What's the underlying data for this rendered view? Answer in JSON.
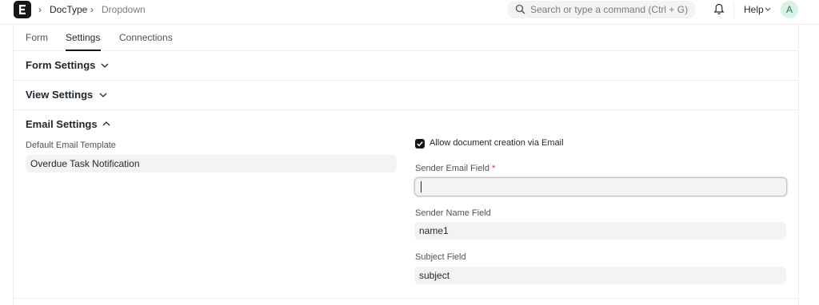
{
  "navbar": {
    "logo_letter": "E",
    "breadcrumb": [
      "DocType",
      "Dropdown"
    ],
    "search_placeholder": "Search or type a command (Ctrl + G)",
    "help_label": "Help",
    "avatar_initial": "A"
  },
  "tabs": [
    {
      "label": "Form",
      "active": false
    },
    {
      "label": "Settings",
      "active": true
    },
    {
      "label": "Connections",
      "active": false
    }
  ],
  "sections": {
    "form_settings": {
      "title": "Form Settings",
      "expanded": false
    },
    "view_settings": {
      "title": "View Settings",
      "expanded": false
    },
    "email_settings": {
      "title": "Email Settings",
      "expanded": true
    }
  },
  "email": {
    "default_template_label": "Default Email Template",
    "default_template_value": "Overdue Task Notification",
    "allow_creation_label": "Allow document creation via Email",
    "allow_creation_checked": true,
    "sender_email_label": "Sender Email Field",
    "required_mark": "*",
    "sender_email_value": "",
    "sender_name_label": "Sender Name Field",
    "sender_name_value": "name1",
    "subject_label": "Subject Field",
    "subject_value": "subject"
  },
  "colors": {
    "accent": "#171717",
    "border": "#ededed",
    "field_bg": "#f3f3f3",
    "required": "#e03636",
    "avatar_bg": "#d8f2e4"
  }
}
